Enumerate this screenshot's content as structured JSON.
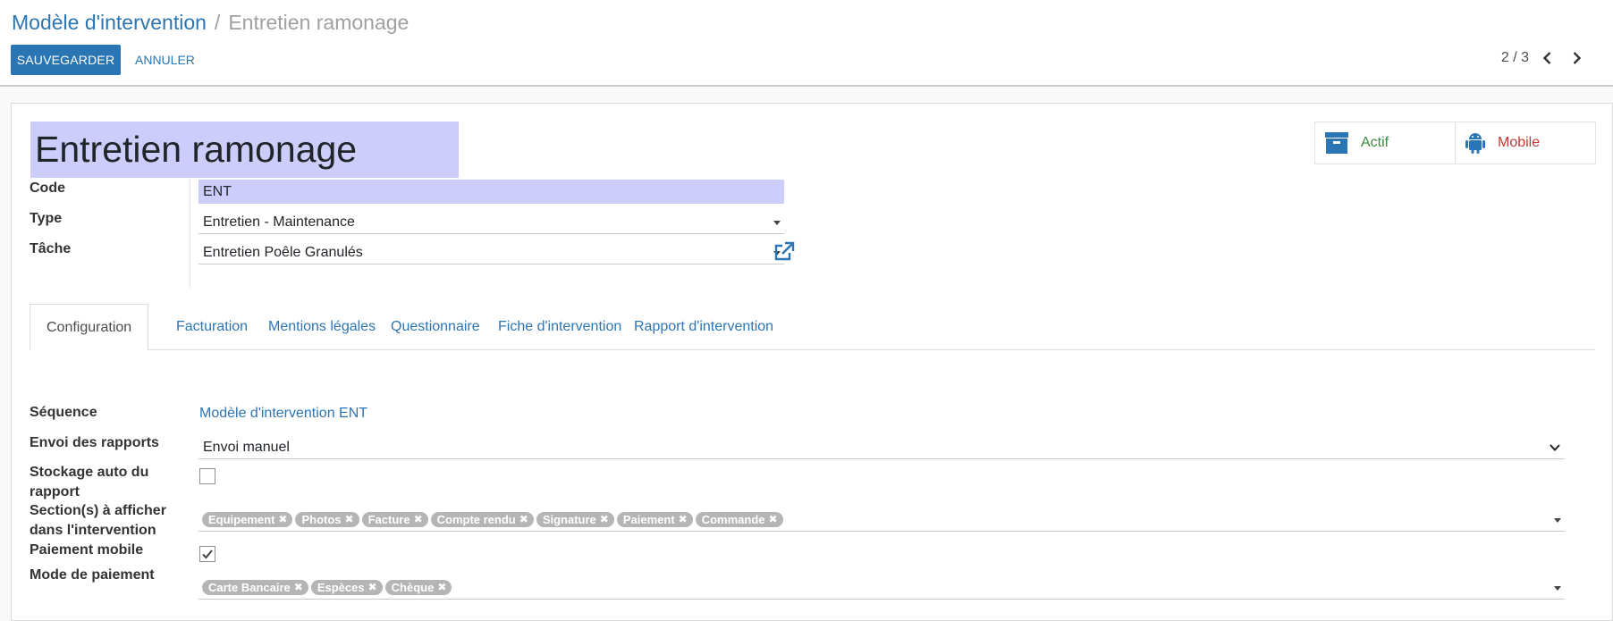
{
  "breadcrumb": {
    "parent": "Modèle d'intervention",
    "separator": "/",
    "current": "Entretien ramonage"
  },
  "toolbar": {
    "save_label": "SAUVEGARDER",
    "cancel_label": "ANNULER"
  },
  "pager": {
    "value": "2 / 3"
  },
  "record": {
    "title": "Entretien ramonage"
  },
  "smart_buttons": {
    "actif": {
      "label": "Actif",
      "icon": "archive-icon",
      "color": "#3b8a3f"
    },
    "mobile": {
      "label": "Mobile",
      "icon": "android-icon",
      "color": "#c13a35"
    }
  },
  "fields": {
    "code": {
      "label": "Code",
      "value": "ENT"
    },
    "type": {
      "label": "Type",
      "value": "Entretien - Maintenance"
    },
    "tache": {
      "label": "Tâche",
      "value": "Entretien Poêle Granulés"
    }
  },
  "tabs": [
    {
      "label": "Configuration",
      "active": true
    },
    {
      "label": "Facturation",
      "active": false
    },
    {
      "label": "Mentions légales",
      "active": false
    },
    {
      "label": "Questionnaire",
      "active": false
    },
    {
      "label": "Fiche d'intervention",
      "active": false
    },
    {
      "label": "Rapport d'intervention",
      "active": false
    }
  ],
  "config": {
    "sequence": {
      "label": "Séquence",
      "value": "Modèle d'intervention ENT"
    },
    "envoi": {
      "label": "Envoi des rapports",
      "value": "Envoi manuel"
    },
    "stockage": {
      "label_line1": "Stockage auto du",
      "label_line2": "rapport",
      "checked": false
    },
    "sections": {
      "label_line1": "Section(s) à afficher",
      "label_line2": "dans l'intervention",
      "tags": [
        "Equipement",
        "Photos",
        "Facture",
        "Compte rendu",
        "Signature",
        "Paiement",
        "Commande"
      ]
    },
    "paiement_mobile": {
      "label": "Paiement mobile",
      "checked": true
    },
    "mode_paiement": {
      "label": "Mode de paiement",
      "tags": [
        "Carte Bancaire",
        "Espèces",
        "Chèque"
      ]
    }
  },
  "colors": {
    "primary": "#2a75b3",
    "link": "#2c75b4",
    "required_field_bg": "#cdcdfb",
    "tag_bg": "#b5b5b5"
  }
}
